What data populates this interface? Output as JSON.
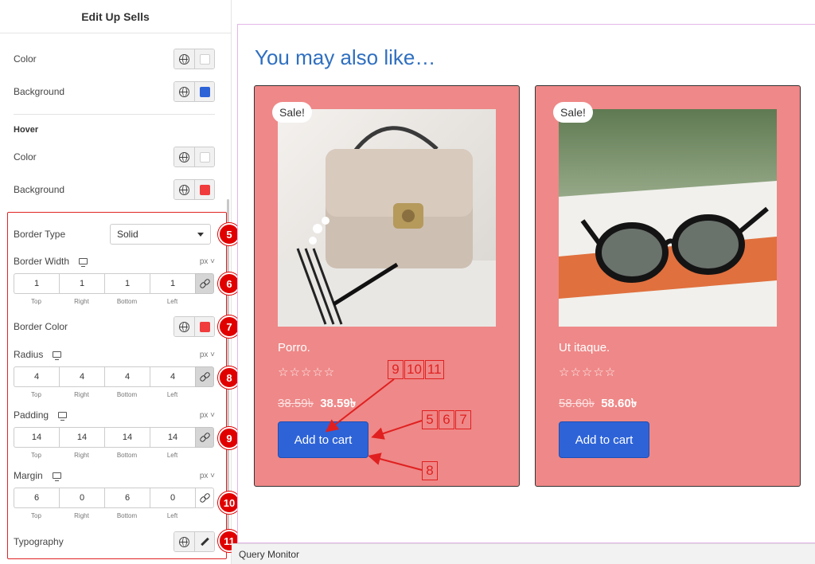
{
  "panel": {
    "title": "Edit Up Sells",
    "normal": {
      "color_label": "Color",
      "color_value": "#ffffff",
      "background_label": "Background",
      "background_value": "#2e63d8"
    },
    "hover": {
      "section_label": "Hover",
      "color_label": "Color",
      "color_value": "#ffffff",
      "background_label": "Background",
      "background_value": "#f03c3c"
    },
    "border_type": {
      "label": "Border Type",
      "value": "Solid"
    },
    "border_width": {
      "label": "Border Width",
      "unit": "px",
      "values": [
        "1",
        "1",
        "1",
        "1"
      ]
    },
    "border_color": {
      "label": "Border Color",
      "value": "#f03c3c"
    },
    "radius": {
      "label": "Radius",
      "unit": "px",
      "values": [
        "4",
        "4",
        "4",
        "4"
      ]
    },
    "padding": {
      "label": "Padding",
      "unit": "px",
      "values": [
        "14",
        "14",
        "14",
        "14"
      ]
    },
    "margin": {
      "label": "Margin",
      "unit": "px",
      "values": [
        "6",
        "0",
        "6",
        "0"
      ]
    },
    "typography": {
      "label": "Typography"
    },
    "dim_labels": [
      "Top",
      "Right",
      "Bottom",
      "Left"
    ]
  },
  "markers": [
    "5",
    "6",
    "7",
    "8",
    "9",
    "10",
    "11"
  ],
  "preview": {
    "heading": "You may also like…",
    "products": [
      {
        "badge": "Sale!",
        "title": "Porro.",
        "stars": "☆☆☆☆☆",
        "old_price": "38.59৳",
        "new_price": "38.59৳",
        "button": "Add to cart"
      },
      {
        "badge": "Sale!",
        "title": "Ut itaque.",
        "stars": "☆☆☆☆☆",
        "old_price": "58.60৳",
        "new_price": "58.60৳",
        "button": "Add to cart"
      }
    ]
  },
  "annotations": {
    "group_a": [
      "9",
      "10",
      "11"
    ],
    "group_b": [
      "5",
      "6",
      "7"
    ],
    "group_c": [
      "8"
    ]
  },
  "query_monitor": "Query Monitor",
  "colors": {
    "accent": "#2f6fc0",
    "card_bg": "#ef8888",
    "button": "#2e63d8",
    "marker": "#e00000"
  }
}
